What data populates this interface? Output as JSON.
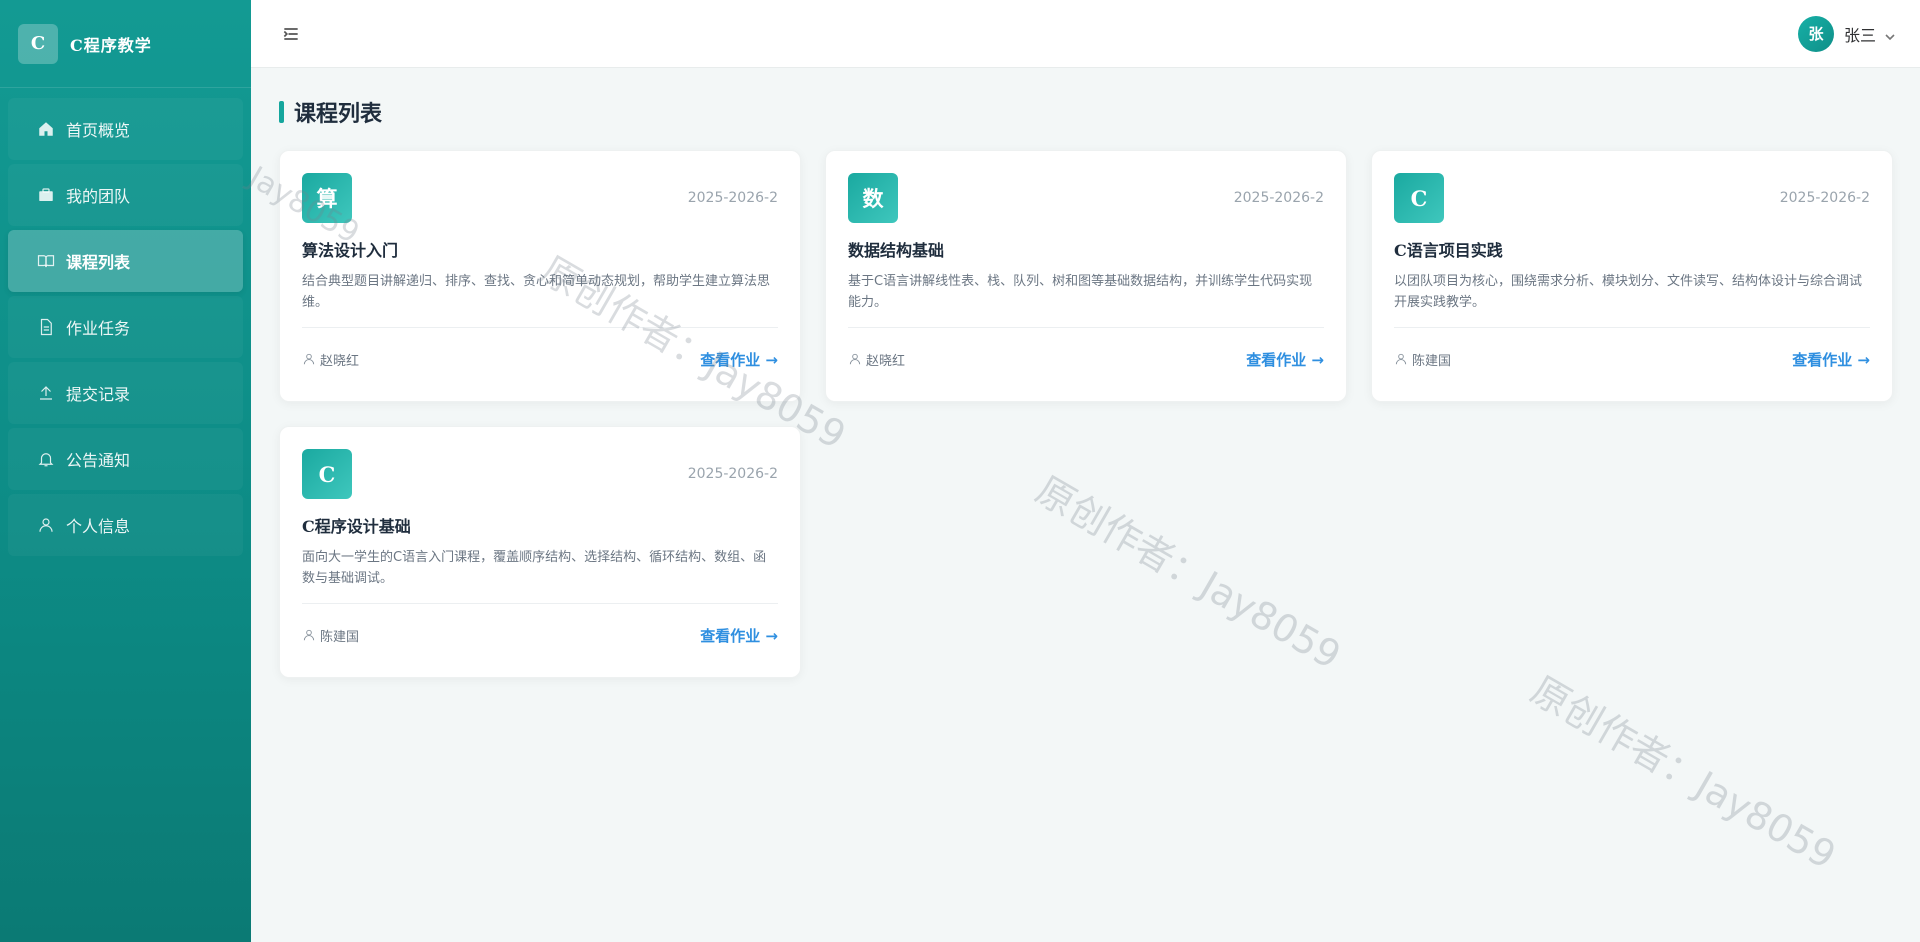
{
  "brand": {
    "logo_letter": "C",
    "name": "C程序教学"
  },
  "sidebar": {
    "items": [
      {
        "label": "首页概览",
        "icon": "home-icon",
        "active": false
      },
      {
        "label": "我的团队",
        "icon": "briefcase-icon",
        "active": false
      },
      {
        "label": "课程列表",
        "icon": "book-icon",
        "active": true
      },
      {
        "label": "作业任务",
        "icon": "document-icon",
        "active": false
      },
      {
        "label": "提交记录",
        "icon": "upload-icon",
        "active": false
      },
      {
        "label": "公告通知",
        "icon": "bell-icon",
        "active": false
      },
      {
        "label": "个人信息",
        "icon": "user-icon",
        "active": false
      }
    ]
  },
  "header": {
    "user": {
      "avatar_char": "张",
      "name": "张三"
    }
  },
  "main": {
    "title": "课程列表",
    "courses": [
      {
        "icon_char": "算",
        "term": "2025-2026-2",
        "title": "算法设计入门",
        "description": "结合典型题目讲解递归、排序、查找、贪心和简单动态规划，帮助学生建立算法思维。",
        "teacher": "赵晓红",
        "action": "查看作业 →"
      },
      {
        "icon_char": "数",
        "term": "2025-2026-2",
        "title": "数据结构基础",
        "description": "基于C语言讲解线性表、栈、队列、树和图等基础数据结构，并训练学生代码实现能力。",
        "teacher": "赵晓红",
        "action": "查看作业 →"
      },
      {
        "icon_char": "C",
        "term": "2025-2026-2",
        "title": "C语言项目实践",
        "description": "以团队项目为核心，围绕需求分析、模块划分、文件读写、结构体设计与综合调试开展实践教学。",
        "teacher": "陈建国",
        "action": "查看作业 →"
      },
      {
        "icon_char": "C",
        "term": "2025-2026-2",
        "title": "C程序设计基础",
        "description": "面向大一学生的C语言入门课程，覆盖顺序结构、选择结构、循环结构、数组、函数与基础调试。",
        "teacher": "陈建国",
        "action": "查看作业 →"
      }
    ]
  },
  "watermark": {
    "text": "原创作者：Jay8059",
    "short_text": "Jay8059"
  },
  "colors": {
    "accent": "#14a69d",
    "link": "#2f8fe0",
    "sidebar": "#0d8c86"
  }
}
